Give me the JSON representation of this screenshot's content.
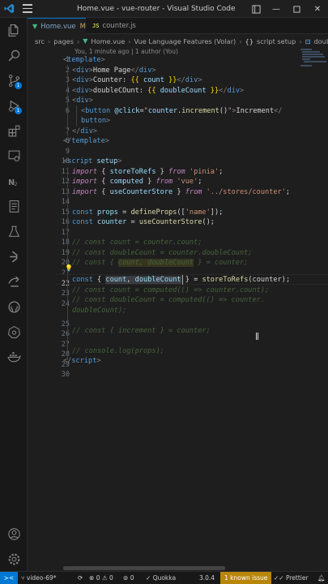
{
  "window": {
    "title": "Home.vue - vue-router - Visual Studio Code"
  },
  "tabs": [
    {
      "label": "Home.vue",
      "modifier": "M",
      "active": true
    },
    {
      "label": "counter.js",
      "active": false
    }
  ],
  "breadcrumb": [
    "src",
    "pages",
    "Home.vue",
    "Vue Language Features (Volar)",
    "script setup",
    "doubleCount"
  ],
  "blame": "You, 1 minute ago | 1 author (You)",
  "activity_badges": {
    "source_control": "1",
    "run_debug": "1"
  },
  "code": {
    "l1": {
      "o": "<",
      "t": "template",
      "c": ">"
    },
    "l2": {
      "o1": "<",
      "t1": "div",
      "c1": ">",
      "txt": "Home Page",
      "o2": "</",
      "t2": "div",
      "c2": ">"
    },
    "l3": {
      "o1": "<",
      "t1": "div",
      "c1": ">",
      "txt": "Counter: ",
      "m1": "{{",
      "v": " count ",
      "m2": "}}",
      "o2": "</",
      "t2": "div",
      "c2": ">"
    },
    "l4": {
      "o1": "<",
      "t1": "div",
      "c1": ">",
      "txt": "doubleCOunt: ",
      "m1": "{{",
      "v": " doubleCount ",
      "m2": "}}",
      "o2": "</",
      "t2": "div",
      "c2": ">"
    },
    "l5": {
      "o": "<",
      "t": "div",
      "c": ">"
    },
    "l6": {
      "o": "<",
      "t": "button",
      "attr": " @click",
      "eq": "=",
      "q1": "\"",
      "obj": "counter",
      "dot": ".",
      "fn": "increment",
      "par": "()",
      "q2": "\"",
      "c": ">",
      "txt": "Increment",
      "close": "</"
    },
    "l7": {
      "t": "button",
      "c": ">"
    },
    "l8": {
      "o": "</",
      "t": "div",
      "c": ">"
    },
    "l9": {
      "o": "</",
      "t": "template",
      "c": ">"
    },
    "l11": {
      "o": "<",
      "t": "script",
      "a": " setup",
      "c": ">"
    },
    "l12": {
      "kw": "import",
      "b1": " { ",
      "id": "storeToRefs",
      "b2": " } ",
      "from": "from",
      "str": " 'pinia'",
      "semi": ";"
    },
    "l13": {
      "kw": "import",
      "b1": " { ",
      "id": "computed",
      "b2": " } ",
      "from": "from",
      "str": " 'vue'",
      "semi": ";"
    },
    "l14": {
      "kw": "import",
      "b1": " { ",
      "id": "useCounterStore",
      "b2": " } ",
      "from": "from",
      "str": " '../stores/counter'",
      "semi": ";"
    },
    "l16": {
      "kw": "const",
      "v": " props ",
      "eq": "= ",
      "fn": "defineProps",
      "arg1": "([",
      "str": "'name'",
      "arg2": "]);"
    },
    "l17": {
      "kw": "const",
      "v": " counter ",
      "eq": "= ",
      "fn": "useCounterStore",
      "arg": "();"
    },
    "l19": "// const count = counter.count;",
    "l20": "// const doubleCount = counter.doubleCount;",
    "l21": {
      "a": "// const { ",
      "b": "count, doubleCount",
      "c": " } = counter;"
    },
    "l22": {
      "kw": "const",
      "b1": " { ",
      "v1": "count",
      "cm": ", ",
      "v2": "doubleCount",
      "b2": " } ",
      "eq": "= ",
      "fn": "storeToRefs",
      "arg": "(counter);"
    },
    "l23": "// const count = computed(() => counter.count);",
    "l24a": "// const doubleCount = computed(() => counter.",
    "l24b": "doubleCount);",
    "l26": "// const { increment } = counter;",
    "l28": "// console.log(props);",
    "l29": {
      "o": "</",
      "t": "script",
      "c": ">"
    }
  },
  "line_numbers": [
    "1",
    "2",
    "3",
    "4",
    "5",
    "6",
    "",
    "7",
    "8",
    "9",
    "10",
    "11",
    "12",
    "13",
    "14",
    "15",
    "16",
    "17",
    "18",
    "19",
    "20",
    "21",
    "22",
    "23",
    "24",
    "",
    "25",
    "26",
    "27",
    "28",
    "29",
    "30"
  ],
  "statusbar": {
    "branch": "video-69*",
    "errors": "0",
    "warnings": "0",
    "ports": "0",
    "quokka": "Quokka",
    "version": "3.0.4",
    "issue": "1 known issue",
    "prettier": "Prettier"
  }
}
